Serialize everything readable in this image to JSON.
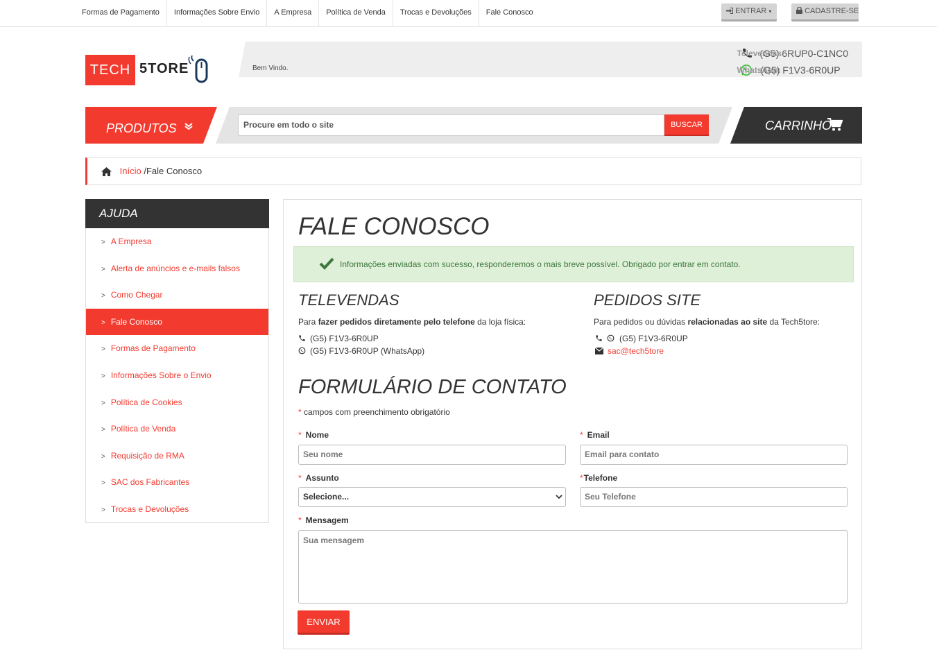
{
  "topbar": {
    "links": [
      "Formas de Pagamento",
      "Informações Sobre Envio",
      "A Empresa",
      "Política de Venda",
      "Trocas e Devoluções",
      "Fale Conosco"
    ],
    "login": "ENTRAR",
    "register": "CADASTRE-SE"
  },
  "header": {
    "logo_tech": "TECH",
    "logo_store": "5TORE",
    "welcome": "Bem Vindo.",
    "televendas_label": "Televendas:",
    "televendas_number": "(G5) 6RUP0-C1NC0",
    "whatsapp_label": "WhatsApp:",
    "whatsapp_number": "(G5) F1V3-6R0UP"
  },
  "nav": {
    "products": "PRODUTOS",
    "search_placeholder": "Procure em todo o site",
    "search_button": "BUSCAR",
    "cart": "CARRINHO"
  },
  "breadcrumb": {
    "home": "Início",
    "current": "/Fale Conosco"
  },
  "sidebar": {
    "title": "AJUDA",
    "items": [
      {
        "label": "A Empresa"
      },
      {
        "label": "Alerta de anúncios e e-mails falsos"
      },
      {
        "label": "Como Chegar"
      },
      {
        "label": "Fale Conosco"
      },
      {
        "label": "Formas de Pagamento"
      },
      {
        "label": "Informações Sobre o Envio"
      },
      {
        "label": "Política de Cookies"
      },
      {
        "label": "Política de Venda"
      },
      {
        "label": "Requisição de RMA"
      },
      {
        "label": "SAC dos Fabricantes"
      },
      {
        "label": "Trocas e Devoluções"
      }
    ],
    "active_index": 3
  },
  "main": {
    "title": "FALE CONOSCO",
    "alert": "Informações enviadas com sucesso, responderemos o mais breve possível. Obrigado por entrar em contato.",
    "televendas": {
      "title": "TELEVENDAS",
      "desc_pre": "Para ",
      "desc_bold": "fazer pedidos diretamente pelo telefone",
      "desc_post": " da loja física:",
      "phone": "(G5) F1V3-6R0UP",
      "whatsapp": "(G5) F1V3-6R0UP (WhatsApp)"
    },
    "pedidos": {
      "title": "PEDIDOS SITE",
      "desc_pre": "Para pedidos ou dúvidas ",
      "desc_bold": "relacionadas ao site",
      "desc_post": " da Tech5tore:",
      "phone": "(G5) F1V3-6R0UP",
      "email": "sac@tech5tore"
    },
    "form": {
      "title": "FORMULÁRIO DE CONTATO",
      "required_note": "campos com preenchimento obrigatório",
      "nome_label": "Nome",
      "nome_placeholder": "Seu nome",
      "email_label": "Email",
      "email_placeholder": "Email para contato",
      "assunto_label": "Assunto",
      "assunto_value": "Selecione...",
      "telefone_label": "Telefone",
      "telefone_placeholder": "Seu Telefone",
      "mensagem_label": "Mensagem",
      "mensagem_placeholder": "Sua mensagem",
      "submit": "ENVIAR"
    }
  },
  "colors": {
    "accent": "#f33a2f",
    "dark": "#333333",
    "success_bg": "#dff0d8",
    "success_text": "#3c763d"
  }
}
